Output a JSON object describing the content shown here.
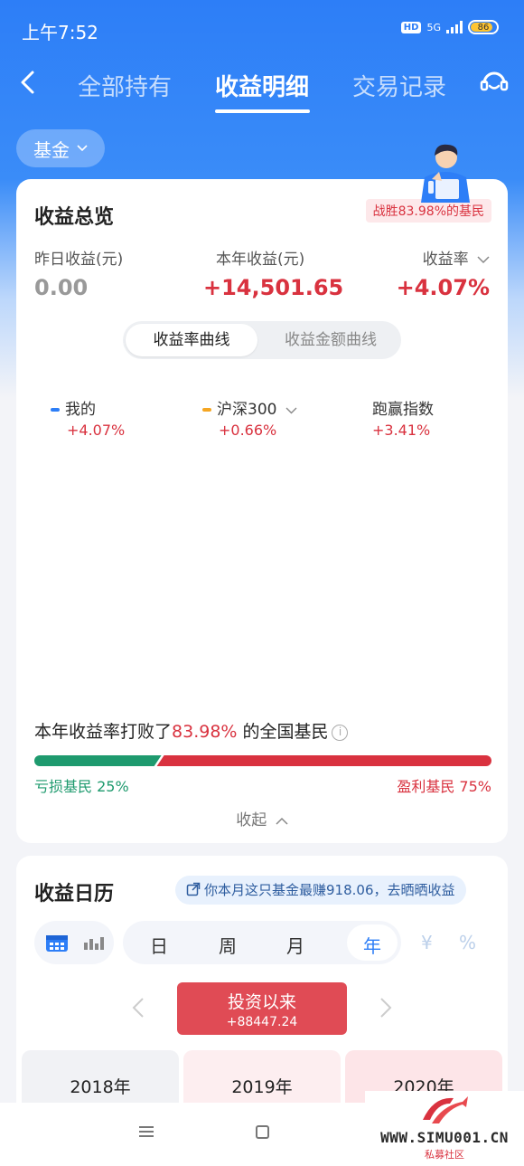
{
  "status_bar": {
    "time": "上午7:52",
    "hd": "HD",
    "network": "5G",
    "battery": "86"
  },
  "nav": {
    "tabs": [
      {
        "label": "全部持有"
      },
      {
        "label": "收益明细"
      },
      {
        "label": "交易记录"
      }
    ],
    "active_tab": "收益明细"
  },
  "filter": {
    "label": "基金"
  },
  "overview": {
    "title": "收益总览",
    "beat_badge": "战胜83.98%的基民",
    "metrics": [
      {
        "label": "昨日收益(元)",
        "value": "0.00"
      },
      {
        "label": "本年收益(元)",
        "value": "+14,501.65"
      },
      {
        "label": "收益率",
        "value": "+4.07%"
      }
    ],
    "curve_tabs": [
      "收益率曲线",
      "收益金额曲线"
    ],
    "legend": [
      {
        "label": "我的",
        "value": "+4.07%",
        "color": "#2d7ef7"
      },
      {
        "label": "沪深300",
        "value": "+0.66%",
        "color": "#f5a623"
      },
      {
        "label": "跑赢指数",
        "value": "+3.41%"
      }
    ],
    "beat_text": {
      "prefix": "本年收益率打败了",
      "pct": "83.98%",
      "suffix": "的全国基民"
    },
    "loss_label": "亏损基民 25%",
    "profit_label": "盈利基民 75%",
    "loss_fraction": 0.27,
    "collapse": "收起"
  },
  "calendar": {
    "title": "收益日历",
    "link": "你本月这只基金最赚918.06，去晒晒收益",
    "periods": [
      "日",
      "周",
      "月",
      "年"
    ],
    "active_period": "年",
    "units": [
      "¥",
      "%"
    ],
    "since_label": "投资以来",
    "since_value": "+88447.24",
    "years": [
      "2018年",
      "2019年",
      "2020年"
    ]
  },
  "watermark": {
    "site": "WWW.SIMU001.CN",
    "sub": "私募社区"
  },
  "colors": {
    "brand_blue": "#2d7ef7",
    "red": "#d9323f",
    "green": "#1e9a6e"
  }
}
